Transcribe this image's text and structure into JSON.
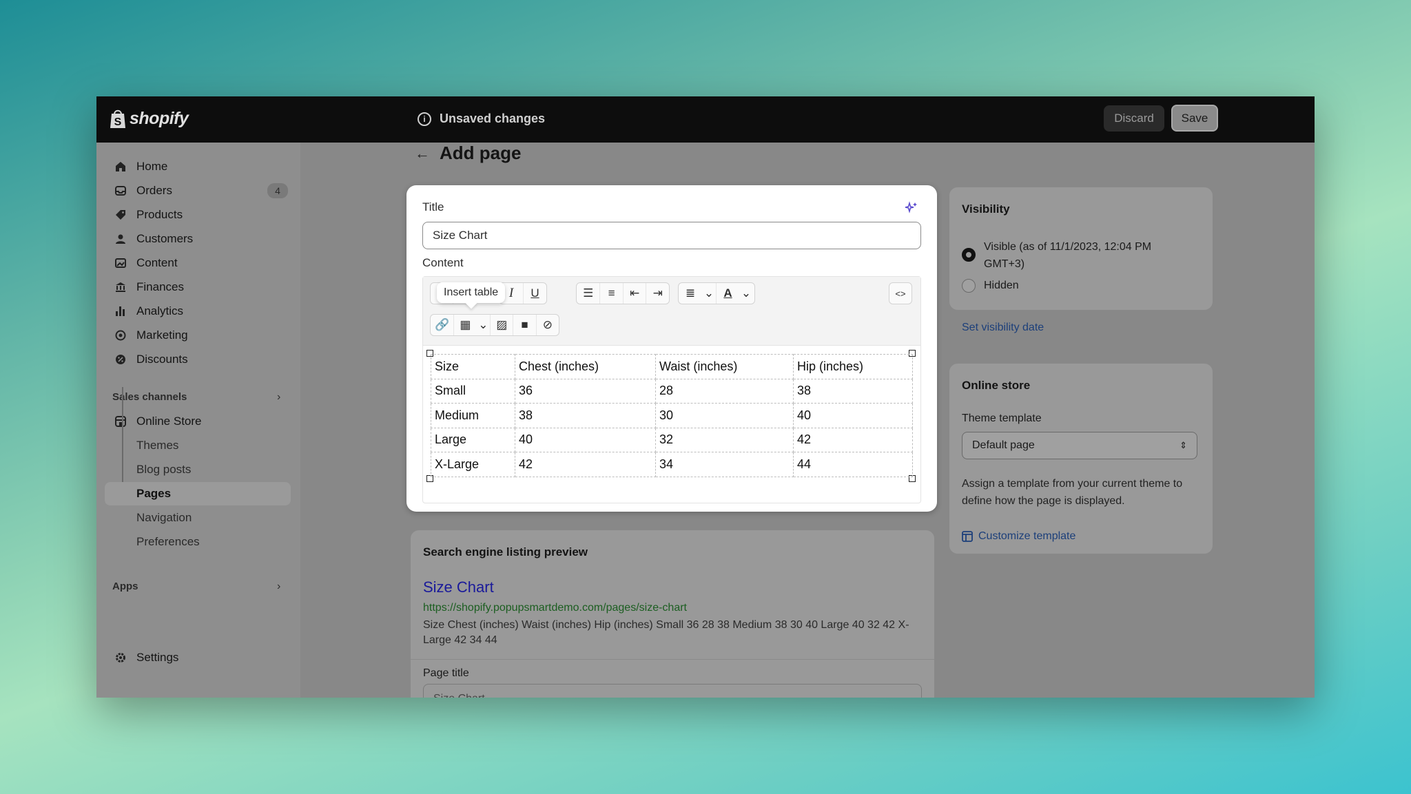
{
  "topbar": {
    "brand": "shopify",
    "unsaved": "Unsaved changes",
    "discard_label": "Discard",
    "save_label": "Save"
  },
  "sidebar": {
    "items": [
      {
        "label": "Home",
        "icon": "home-icon"
      },
      {
        "label": "Orders",
        "icon": "inbox-icon",
        "badge": "4"
      },
      {
        "label": "Products",
        "icon": "tag-icon"
      },
      {
        "label": "Customers",
        "icon": "person-icon"
      },
      {
        "label": "Content",
        "icon": "image-icon"
      },
      {
        "label": "Finances",
        "icon": "bank-icon"
      },
      {
        "label": "Analytics",
        "icon": "bar-chart-icon"
      },
      {
        "label": "Marketing",
        "icon": "target-icon"
      },
      {
        "label": "Discounts",
        "icon": "discount-icon"
      }
    ],
    "sales_channels_label": "Sales channels",
    "online_store": "Online Store",
    "sub_items": [
      "Themes",
      "Blog posts",
      "Pages",
      "Navigation",
      "Preferences"
    ],
    "apps_label": "Apps",
    "settings_label": "Settings"
  },
  "page": {
    "title": "Add page"
  },
  "editor": {
    "title_label": "Title",
    "title_value": "Size Chart",
    "content_label": "Content",
    "tooltip": "Insert table",
    "table": [
      [
        "Size",
        "Chest (inches)",
        "Waist (inches)",
        "Hip (inches)"
      ],
      [
        "Small",
        "36",
        "28",
        "38"
      ],
      [
        "Medium",
        "38",
        "30",
        "40"
      ],
      [
        "Large",
        "40",
        "32",
        "42"
      ],
      [
        "X-Large",
        "42",
        "34",
        "44"
      ]
    ]
  },
  "seo": {
    "heading": "Search engine listing preview",
    "link": "Size Chart",
    "url": "https://shopify.popupsmartdemo.com/pages/size-chart",
    "description": "Size Chest (inches) Waist (inches) Hip (inches) Small 36 28 38 Medium 38 30 40 Large 40 32 42 X-Large 42 34 44",
    "page_title_label": "Page title",
    "page_title_value": "Size Chart"
  },
  "visibility": {
    "heading": "Visibility",
    "visible_label": "Visible (as of 11/1/2023, 12:04 PM GMT+3)",
    "hidden_label": "Hidden",
    "set_date_link": "Set visibility date"
  },
  "online_store": {
    "heading": "Online store",
    "theme_template_label": "Theme template",
    "theme_template_value": "Default page",
    "help": "Assign a template from your current theme to define how the page is displayed.",
    "customize_link": "Customize template"
  }
}
